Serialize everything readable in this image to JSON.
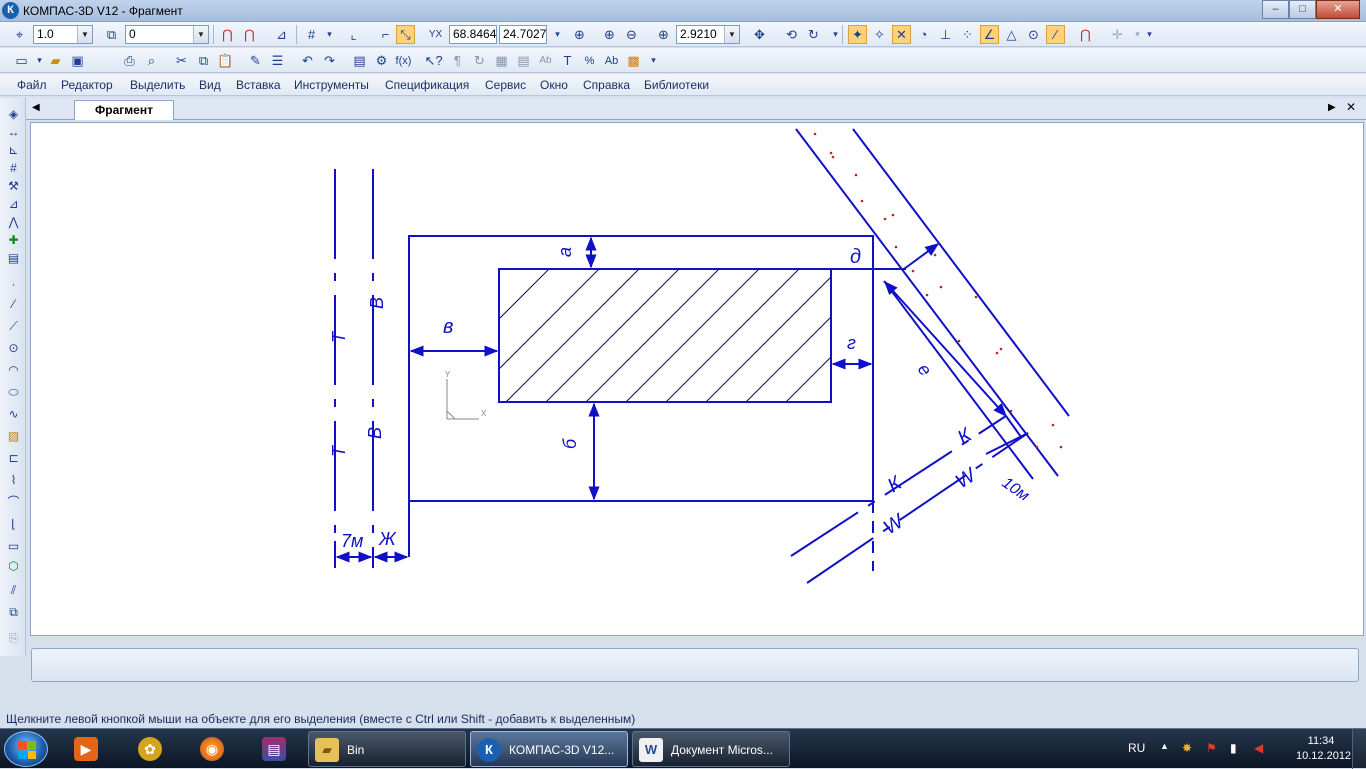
{
  "window": {
    "title": "КОМПАС-3D V12 - Фрагмент",
    "app_icon_letter": "К",
    "minimize": "–",
    "maximize": "□",
    "close": "✕"
  },
  "toolbar1": {
    "scale_value": "1.0",
    "layer_value": "0",
    "coord_x": "68.8464",
    "coord_y": "24.7027",
    "zoom_value": "2.9210"
  },
  "menu": [
    "Файл",
    "Редактор",
    "Выделить",
    "Вид",
    "Вставка",
    "Инструменты",
    "Спецификация",
    "Сервис",
    "Окно",
    "Справка",
    "Библиотеки"
  ],
  "document": {
    "tab_label": "Фрагмент",
    "nav_left": "◀",
    "nav_right": "▶",
    "close": "✕"
  },
  "drawing": {
    "labels": {
      "a": "а",
      "b": "б",
      "v": "в",
      "g": "г",
      "d": "д",
      "e": "е",
      "zh": "Ж",
      "seven_m": "7м",
      "ten_m": "10м",
      "T": "Т",
      "V": "В",
      "K": "К",
      "W": "W",
      "axis_x": "X",
      "axis_y": "Y"
    },
    "line_color": "#1010c8",
    "hatch_color": "#10104a",
    "dot_color": "#c0281e"
  },
  "status": {
    "hint": "Щелкните левой кнопкой мыши на объекте для его выделения (вместе с Ctrl или Shift - добавить к выделенным)"
  },
  "taskbar": {
    "tasks": [
      {
        "label": "Bin"
      },
      {
        "label": "КОМПАС-3D V12..."
      },
      {
        "label": "Документ Micros..."
      }
    ],
    "language": "RU",
    "time": "11:34",
    "date": "10.12.2012"
  }
}
